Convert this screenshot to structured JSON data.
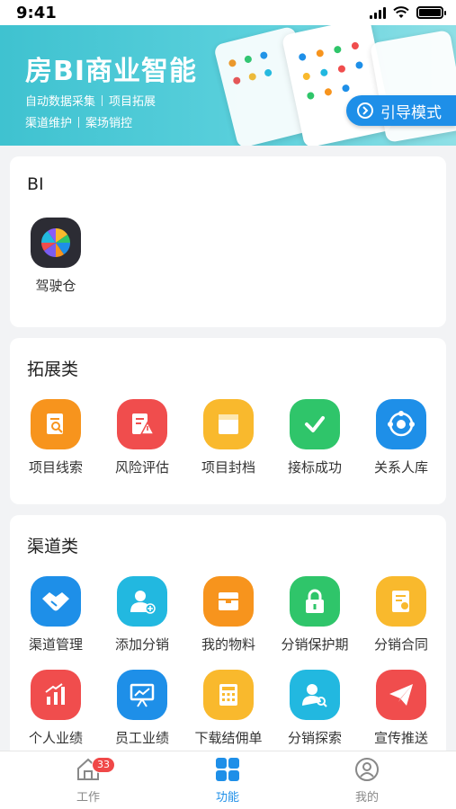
{
  "status_bar": {
    "time": "9:41"
  },
  "banner": {
    "title": "房BI商业智能",
    "tags_row1": [
      "自动数据采集",
      "项目拓展"
    ],
    "tags_row2": [
      "渠道维护",
      "案场销控"
    ],
    "guide_button": "引导模式"
  },
  "bi_section": {
    "title": "BI",
    "items": [
      {
        "label": "驾驶仓",
        "icon": "pinwheel-icon"
      }
    ]
  },
  "expand_section": {
    "title": "拓展类",
    "items": [
      {
        "label": "项目线索",
        "icon": "doc-search-icon",
        "color": "#f7941d"
      },
      {
        "label": "风险评估",
        "icon": "doc-warning-icon",
        "color": "#f04d4d"
      },
      {
        "label": "项目封档",
        "icon": "archive-icon",
        "color": "#f9b92d"
      },
      {
        "label": "接标成功",
        "icon": "checkmark-icon",
        "color": "#2fc56a"
      },
      {
        "label": "关系人库",
        "icon": "network-icon",
        "color": "#1e8fe8"
      }
    ]
  },
  "channel_section": {
    "title": "渠道类",
    "row1": [
      {
        "label": "渠道管理",
        "icon": "handshake-icon",
        "color": "#1e8fe8"
      },
      {
        "label": "添加分销",
        "icon": "add-user-icon",
        "color": "#22b8e0"
      },
      {
        "label": "我的物料",
        "icon": "box-icon",
        "color": "#f7941d"
      },
      {
        "label": "分销保护期",
        "icon": "lock-icon",
        "color": "#2fc56a"
      },
      {
        "label": "分销合同",
        "icon": "contract-icon",
        "color": "#f9b92d"
      }
    ],
    "row2": [
      {
        "label": "个人业绩",
        "icon": "bar-up-icon",
        "color": "#f04d4d"
      },
      {
        "label": "员工业绩",
        "icon": "presentation-icon",
        "color": "#1e8fe8"
      },
      {
        "label": "下载结佣单",
        "icon": "calculator-icon",
        "color": "#f9b92d"
      },
      {
        "label": "分销探索",
        "icon": "user-search-icon",
        "color": "#22b8e0"
      },
      {
        "label": "宣传推送",
        "icon": "paper-plane-icon",
        "color": "#f04d4d"
      }
    ]
  },
  "tab_bar": {
    "tabs": [
      {
        "label": "工作",
        "badge": "33",
        "active": false
      },
      {
        "label": "功能",
        "active": true
      },
      {
        "label": "我的",
        "active": false
      }
    ],
    "active_color": "#1e8fe8",
    "inactive_color": "#888888"
  }
}
